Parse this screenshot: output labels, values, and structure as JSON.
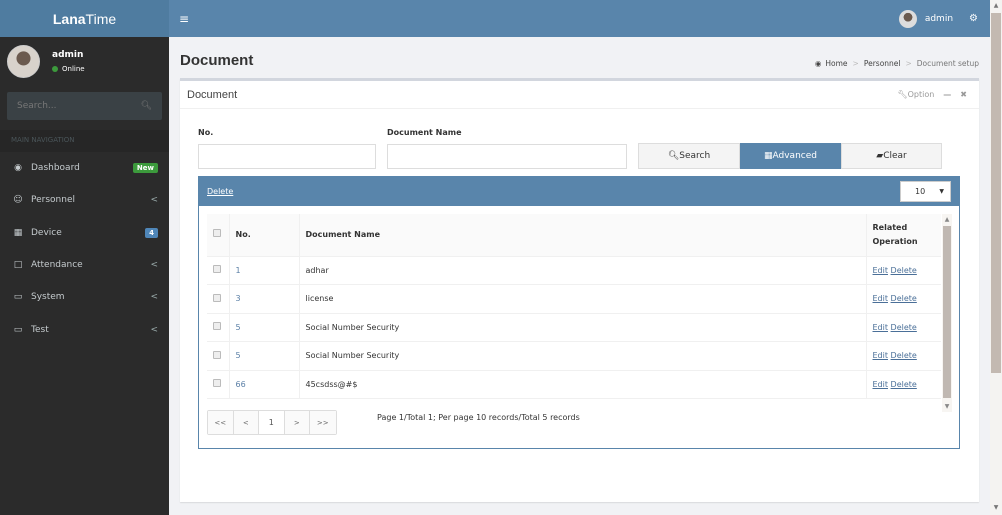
{
  "app": {
    "logo_bold": "Lana",
    "logo_thin": "Time"
  },
  "sidebar": {
    "user": {
      "name": "admin",
      "status": "Online"
    },
    "search_placeholder": "Search...",
    "nav_header": "MAIN NAVIGATION",
    "items": [
      {
        "label": "Dashboard",
        "icon": "dashboard-icon",
        "badge": "New"
      },
      {
        "label": "Personnel",
        "icon": "users-icon",
        "chevron": "<"
      },
      {
        "label": "Device",
        "icon": "building-icon",
        "badge": "4"
      },
      {
        "label": "Attendance",
        "icon": "note-icon",
        "chevron": "<"
      },
      {
        "label": "System",
        "icon": "laptop-icon",
        "chevron": "<"
      },
      {
        "label": "Test",
        "icon": "laptop-icon",
        "chevron": "<"
      }
    ]
  },
  "topbar": {
    "menu_icon": "≡",
    "user_name": "admin"
  },
  "page": {
    "title": "Document",
    "breadcrumb": [
      "Home",
      "Personnel",
      "Document setup"
    ]
  },
  "box": {
    "title": "Document",
    "option_label": "Option",
    "filters": {
      "no_label": "No.",
      "no_value": "",
      "name_label": "Document Name",
      "name_value": ""
    },
    "buttons": {
      "search": "Search",
      "advanced": "Advanced",
      "clear": "Clear"
    },
    "grid": {
      "delete_label": "Delete",
      "per_page": "10",
      "columns": [
        "No.",
        "Document Name",
        "Related Operation"
      ],
      "related_line1": "Related",
      "related_line2": "Operation",
      "rows": [
        {
          "no": "1",
          "name": "adhar",
          "edit": "Edit",
          "delete": "Delete"
        },
        {
          "no": "3",
          "name": "license",
          "edit": "Edit",
          "delete": "Delete"
        },
        {
          "no": "5",
          "name": "Social Number Security",
          "edit": "Edit",
          "delete": "Delete"
        },
        {
          "no": "5",
          "name": "Social Number Security",
          "edit": "Edit",
          "delete": "Delete"
        },
        {
          "no": "66",
          "name": "45csdss@#$",
          "edit": "Edit",
          "delete": "Delete"
        }
      ],
      "pager": {
        "first": "<<",
        "prev": "<",
        "current": "1",
        "next": ">",
        "last": ">>"
      },
      "page_info": "Page 1/Total 1; Per page 10 records/Total 5 records"
    }
  },
  "colors": {
    "primary": "#5985ab",
    "sidebar": "#2b2b2b",
    "badge_new": "#3c9a3c",
    "badge_count": "#4f86b8"
  }
}
